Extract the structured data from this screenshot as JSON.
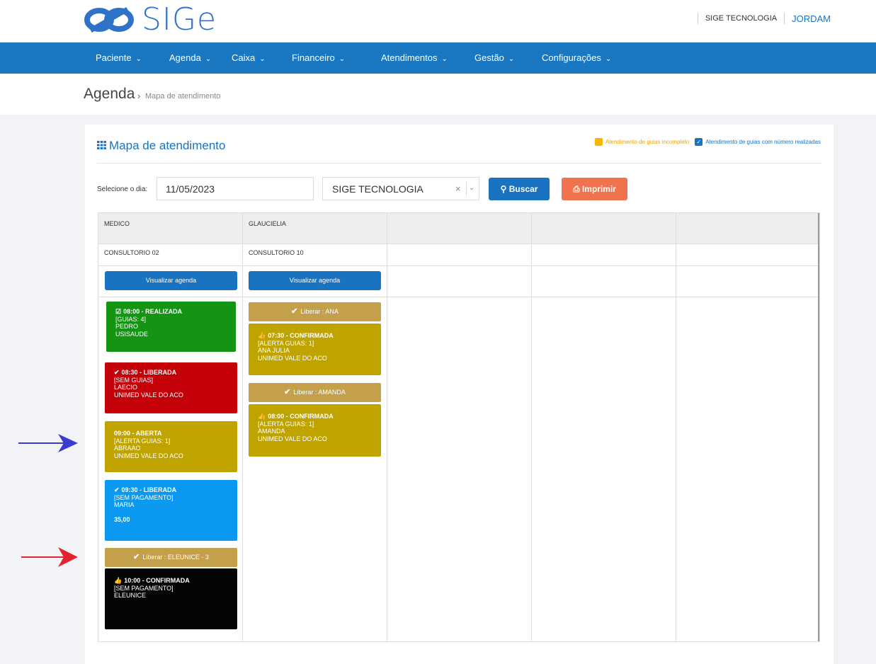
{
  "app": {
    "logo_text": "SIGe",
    "company": "SIGE TECNOLOGIA",
    "user": "JORDAM"
  },
  "nav": {
    "items": [
      {
        "label": "Paciente"
      },
      {
        "label": "Agenda"
      },
      {
        "label": "Caixa"
      },
      {
        "label": "Financeiro"
      },
      {
        "label": "Atendimentos"
      },
      {
        "label": "Gestão"
      },
      {
        "label": "Configurações"
      }
    ]
  },
  "breadcrumb": {
    "title": "Agenda",
    "sep": "›",
    "sub": "Mapa de atendimento"
  },
  "panel": {
    "title": "Mapa de atendimento",
    "legend": {
      "incomplete_label": "Atendimento de guias incompleto",
      "incomplete_color": "#f5b800",
      "done_label": "Atendimento de guias com número realizadas",
      "done_color": "#1a73c0"
    }
  },
  "filters": {
    "day_label": "Selecione o dia:",
    "date_value": "11/05/2023",
    "clinic_value": "SIGE TECNOLOGIA",
    "clear_glyph": "×",
    "search_label": "Buscar",
    "print_label": "Imprimir"
  },
  "columns": [
    {
      "doctor": "MEDICO",
      "room": "CONSULTORIO 02",
      "view_label": "Visualizar agenda"
    },
    {
      "doctor": "GLAUCIELIA",
      "room": "CONSULTORIO 10",
      "view_label": "Visualizar agenda"
    },
    {
      "doctor": "",
      "room": ""
    },
    {
      "doctor": "",
      "room": ""
    },
    {
      "doctor": "",
      "room": ""
    }
  ],
  "appointments": {
    "col1": [
      {
        "title": "08:00 - REALIZADA",
        "lines": [
          "[GUIAS: 4]",
          "PEDRO",
          "USISAUDE"
        ],
        "color": "#139413",
        "icon": "checkbox-icon"
      },
      {
        "title": "08:30 - LIBERADA",
        "lines": [
          "[SEM GUIAS]",
          "LAECIO",
          "UNIMED VALE DO ACO"
        ],
        "color": "#c40008",
        "icon": "check-icon"
      },
      {
        "title": "09:00 - ABERTA",
        "lines": [
          "[ALERTA GUIAS: 1]",
          "ABRAAO",
          "UNIMED VALE DO ACO"
        ],
        "color": "#bfa400",
        "icon": ""
      },
      {
        "title": "09:30 - LIBERADA",
        "lines": [
          "[SEM PAGAMENTO]",
          "MARIA",
          "",
          "35,00"
        ],
        "color": "#0b98f0",
        "icon": "check-icon"
      },
      {
        "release": "Liberar : ELEUNICE - 3",
        "title": "10:00 - CONFIRMADA",
        "lines": [
          "[SEM PAGAMENTO]",
          "ELEUNICE"
        ],
        "color": "#050505",
        "icon": "thumbs-up-icon"
      }
    ],
    "col2": [
      {
        "release": "Liberar : ANA",
        "title": "07:30 - CONFIRMADA",
        "lines": [
          "[ALERTA GUIAS: 1]",
          "ANA JULIA",
          "UNIMED VALE DO ACO"
        ],
        "color": "#bfa400",
        "icon": "thumbs-up-icon"
      },
      {
        "release": "Liberar : AMANDA",
        "title": "08:00 - CONFIRMADA",
        "lines": [
          "[ALERTA GUIAS: 1]",
          "AMANDA",
          "UNIMED VALE DO ACO"
        ],
        "color": "#bfa400",
        "icon": "thumbs-up-icon"
      }
    ]
  },
  "annotations": {
    "arrow1_color": "#3b3bd0",
    "arrow2_color": "#e5222b"
  }
}
